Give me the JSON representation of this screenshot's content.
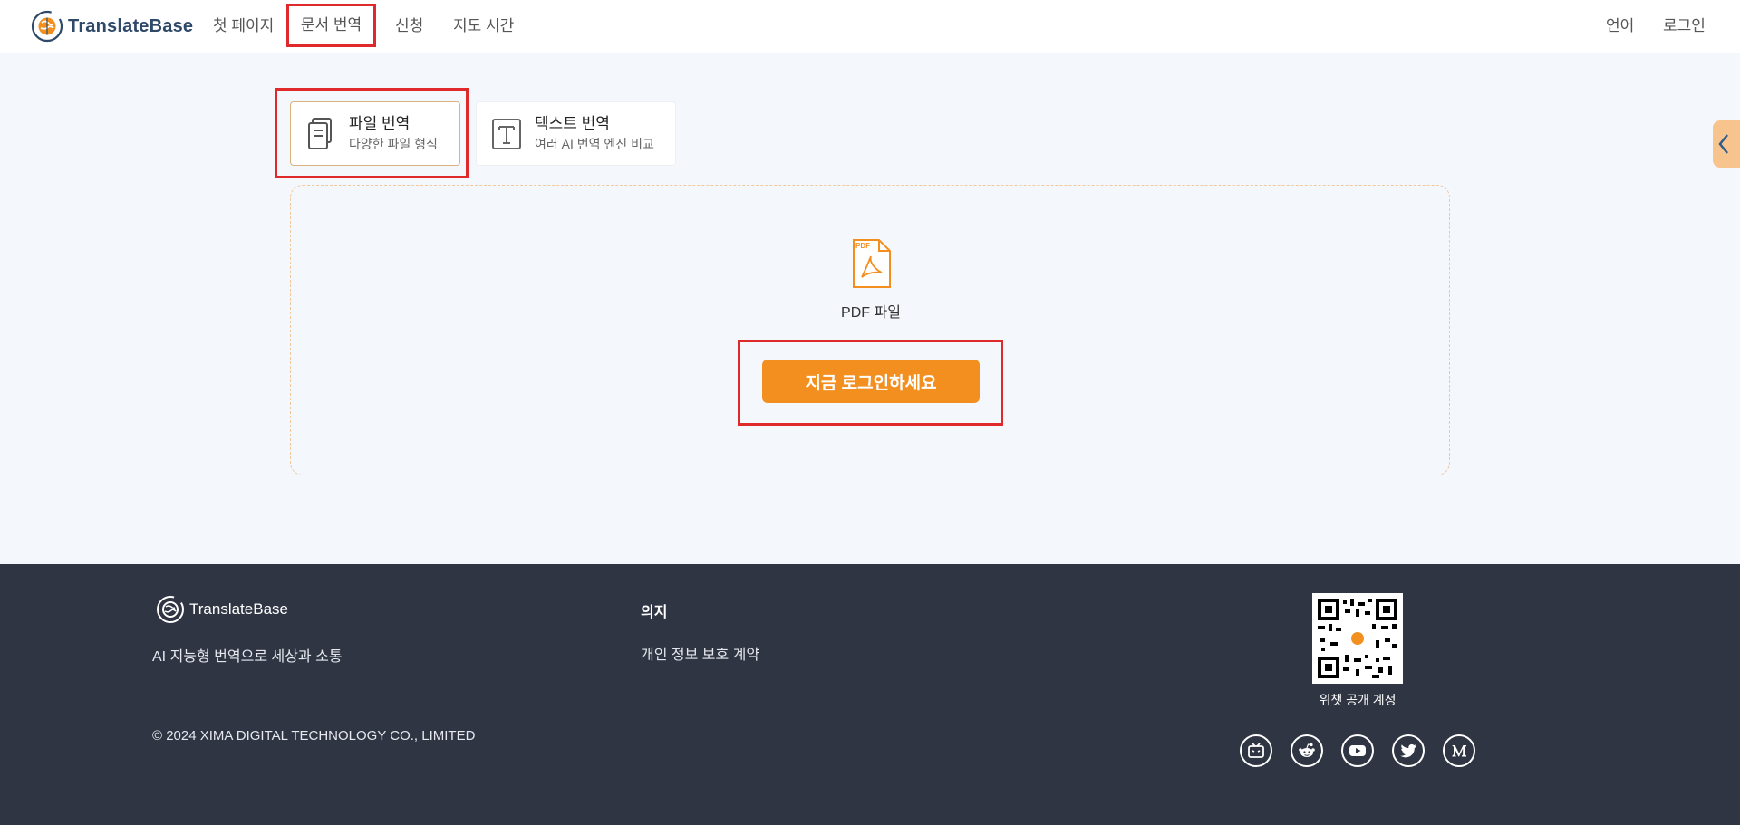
{
  "header": {
    "brand": "TranslateBase",
    "nav": [
      {
        "label": "첫 페이지"
      },
      {
        "label": "문서 번역"
      },
      {
        "label": "신청"
      },
      {
        "label": "지도 시간"
      }
    ],
    "language": "언어",
    "login": "로그인"
  },
  "tabs": [
    {
      "title": "파일 번역",
      "subtitle": "다양한 파일 형식"
    },
    {
      "title": "텍스트 번역",
      "subtitle": "여러 AI 번역 엔진 비교"
    }
  ],
  "upload": {
    "pdf_badge": "PDF",
    "file_type_label": "PDF 파일",
    "login_button": "지금 로그인하세요"
  },
  "footer": {
    "brand": "TranslateBase",
    "slogan": "AI 지능형 번역으로 세상과 소통",
    "copyright": "© 2024 XIMA DIGITAL TECHNOLOGY CO., LIMITED",
    "intent_title": "의지",
    "privacy_link": "개인 정보 보호 계약",
    "qr_label": "위챗 공개 계정",
    "socials": [
      {
        "icon": "bilibili-icon"
      },
      {
        "icon": "reddit-icon"
      },
      {
        "icon": "youtube-icon"
      },
      {
        "icon": "twitter-icon"
      },
      {
        "icon": "medium-icon"
      }
    ]
  },
  "colors": {
    "accent": "#f28f1f",
    "highlight": "#e0292b",
    "footer_bg": "#2f3542",
    "page_bg": "#f4f7fc",
    "brand_text": "#2f4a68"
  }
}
